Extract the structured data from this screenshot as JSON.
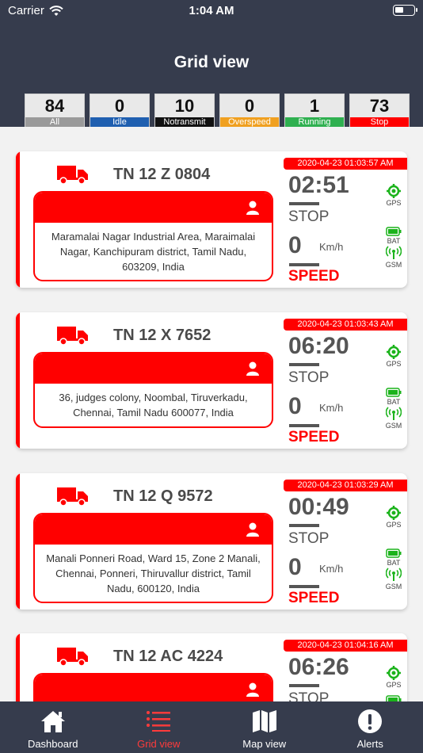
{
  "status_bar": {
    "carrier": "Carrier",
    "time": "1:04 AM"
  },
  "header": {
    "title": "Grid view"
  },
  "stats": [
    {
      "count": "84",
      "label": "All",
      "color": "#9a9a9a"
    },
    {
      "count": "0",
      "label": "Idle",
      "color": "#1f5fb0"
    },
    {
      "count": "10",
      "label": "Notransmit",
      "color": "#111111"
    },
    {
      "count": "0",
      "label": "Overspeed",
      "color": "#f0a020"
    },
    {
      "count": "1",
      "label": "Running",
      "color": "#2fb050"
    },
    {
      "count": "73",
      "label": "Stop",
      "color": "#ff0000"
    }
  ],
  "vehicles": [
    {
      "plate": "TN 12 Z 0804",
      "timestamp": "2020-04-23 01:03:57 AM",
      "duration": "02:51",
      "status": "STOP",
      "speed": "0",
      "unit": "Km/h",
      "speed_label": "SPEED",
      "address": "Maramalai Nagar Industrial Area, Maraimalai Nagar, Kanchipuram district, Tamil Nadu, 603209, India",
      "gps": "GPS",
      "bat": "BAT",
      "gsm": "GSM"
    },
    {
      "plate": "TN 12 X 7652",
      "timestamp": "2020-04-23 01:03:43 AM",
      "duration": "06:20",
      "status": "STOP",
      "speed": "0",
      "unit": "Km/h",
      "speed_label": "SPEED",
      "address": "36, judges colony, Noombal, Tiruverkadu, Chennai, Tamil Nadu 600077, India",
      "gps": "GPS",
      "bat": "BAT",
      "gsm": "GSM"
    },
    {
      "plate": "TN 12 Q 9572",
      "timestamp": "2020-04-23 01:03:29 AM",
      "duration": "00:49",
      "status": "STOP",
      "speed": "0",
      "unit": "Km/h",
      "speed_label": "SPEED",
      "address": "Manali Ponneri Road, Ward 15, Zone 2 Manali, Chennai, Ponneri, Thiruvallur district, Tamil Nadu, 600120, India",
      "gps": "GPS",
      "bat": "BAT",
      "gsm": "GSM"
    },
    {
      "plate": "TN 12 AC 4224",
      "timestamp": "2020-04-23 01:04:16 AM",
      "duration": "06:26",
      "status": "STOP",
      "speed": "",
      "unit": "",
      "speed_label": "",
      "address": "",
      "gps": "GPS",
      "bat": "",
      "gsm": ""
    }
  ],
  "tabs": [
    {
      "label": "Dashboard",
      "icon": "home-icon"
    },
    {
      "label": "Grid view",
      "icon": "list-icon"
    },
    {
      "label": "Map view",
      "icon": "map-icon"
    },
    {
      "label": "Alerts",
      "icon": "alert-icon"
    }
  ],
  "colors": {
    "header_bg": "#363c4d",
    "accent": "#ff0000",
    "active_tab": "#ff3b3b",
    "indicator_green": "#1bb31b"
  }
}
